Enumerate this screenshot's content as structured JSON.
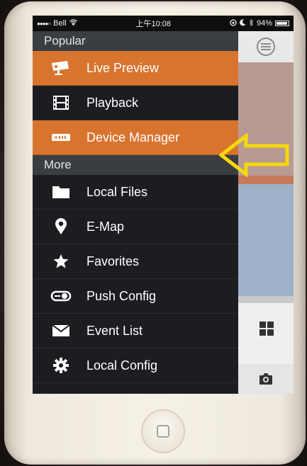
{
  "status_bar": {
    "carrier": "Bell",
    "time": "上午10:08",
    "battery": "94%"
  },
  "menu": {
    "sections": [
      {
        "header": "Popular",
        "items": [
          {
            "label": "Live Preview",
            "icon": "camera-icon",
            "active": true
          },
          {
            "label": "Playback",
            "icon": "film-icon",
            "active": false
          },
          {
            "label": "Device Manager",
            "icon": "device-icon",
            "active": true
          }
        ]
      },
      {
        "header": "More",
        "items": [
          {
            "label": "Local Files",
            "icon": "folder-icon",
            "active": false
          },
          {
            "label": "E-Map",
            "icon": "map-pin-icon",
            "active": false
          },
          {
            "label": "Favorites",
            "icon": "star-icon",
            "active": false
          },
          {
            "label": "Push Config",
            "icon": "toggle-icon",
            "active": false
          },
          {
            "label": "Event List",
            "icon": "envelope-icon",
            "active": false
          },
          {
            "label": "Local Config",
            "icon": "gear-icon",
            "active": false
          }
        ]
      }
    ]
  },
  "colors": {
    "accent": "#d9742f",
    "menu_bg": "#1b1d20",
    "section_header_bg": "#3a3d42",
    "highlight_arrow": "#f5d90a"
  }
}
